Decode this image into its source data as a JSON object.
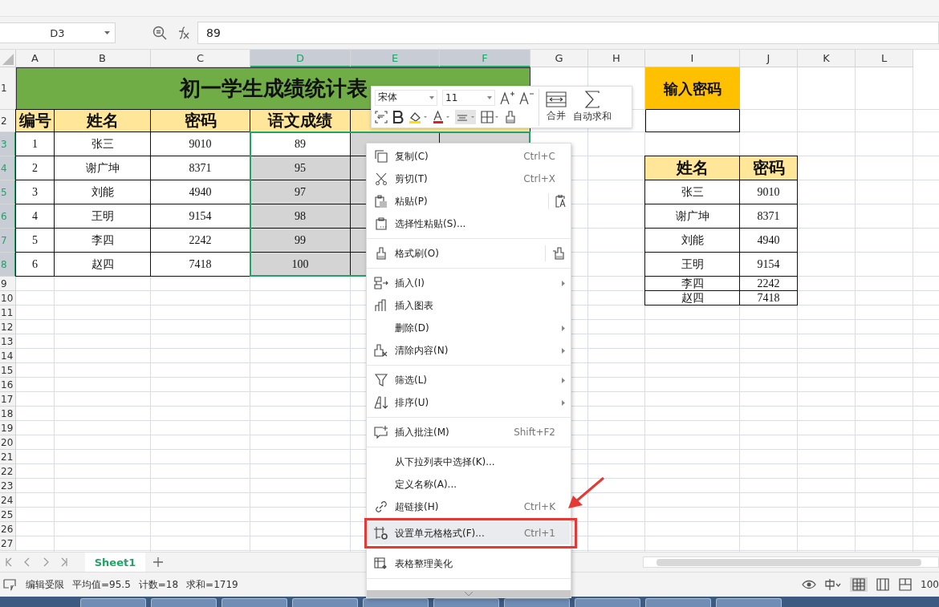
{
  "name_box": "D3",
  "formula": "89",
  "columns": [
    {
      "label": "A",
      "selected": false
    },
    {
      "label": "B",
      "selected": false
    },
    {
      "label": "C",
      "selected": false
    },
    {
      "label": "D",
      "selected": true
    },
    {
      "label": "E",
      "selected": true
    },
    {
      "label": "F",
      "selected": true
    },
    {
      "label": "G",
      "selected": false
    },
    {
      "label": "H",
      "selected": false
    },
    {
      "label": "I",
      "selected": false
    },
    {
      "label": "J",
      "selected": false
    },
    {
      "label": "K",
      "selected": false
    },
    {
      "label": "L",
      "selected": false
    }
  ],
  "rows": [
    {
      "label": "1",
      "selected": false
    },
    {
      "label": "2",
      "selected": false
    },
    {
      "label": "3",
      "selected": true
    },
    {
      "label": "4",
      "selected": true
    },
    {
      "label": "5",
      "selected": true
    },
    {
      "label": "6",
      "selected": true
    },
    {
      "label": "7",
      "selected": true
    },
    {
      "label": "8",
      "selected": true
    },
    {
      "label": "9",
      "selected": false
    },
    {
      "label": "10",
      "selected": false
    },
    {
      "label": "11",
      "selected": false
    },
    {
      "label": "12",
      "selected": false
    },
    {
      "label": "13",
      "selected": false
    },
    {
      "label": "14",
      "selected": false
    },
    {
      "label": "15",
      "selected": false
    },
    {
      "label": "16",
      "selected": false
    },
    {
      "label": "17",
      "selected": false
    },
    {
      "label": "18",
      "selected": false
    },
    {
      "label": "19",
      "selected": false
    },
    {
      "label": "20",
      "selected": false
    },
    {
      "label": "21",
      "selected": false
    },
    {
      "label": "22",
      "selected": false
    },
    {
      "label": "23",
      "selected": false
    },
    {
      "label": "24",
      "selected": false
    },
    {
      "label": "25",
      "selected": false
    },
    {
      "label": "26",
      "selected": false
    },
    {
      "label": "27",
      "selected": false
    }
  ],
  "title": "初一学生成绩统计表",
  "headers": [
    "编号",
    "姓名",
    "密码",
    "语文成绩"
  ],
  "students": [
    {
      "no": "1",
      "name": "张三",
      "code": "9010",
      "score": "89",
      "active": true
    },
    {
      "no": "2",
      "name": "谢广坤",
      "code": "8371",
      "score": "95",
      "active": false
    },
    {
      "no": "3",
      "name": "刘能",
      "code": "4940",
      "score": "97",
      "active": false
    },
    {
      "no": "4",
      "name": "王明",
      "code": "9154",
      "score": "98",
      "active": false
    },
    {
      "no": "5",
      "name": "李四",
      "code": "2242",
      "score": "99",
      "active": false
    },
    {
      "no": "6",
      "name": "赵四",
      "code": "7418",
      "score": "100",
      "active": false
    }
  ],
  "password_label": "输入密码",
  "lookup": {
    "headers": [
      "姓名",
      "密码"
    ],
    "rows": [
      [
        "张三",
        "9010"
      ],
      [
        "谢广坤",
        "8371"
      ],
      [
        "刘能",
        "4940"
      ],
      [
        "王明",
        "9154"
      ],
      [
        "李四",
        "2242"
      ],
      [
        "赵四",
        "7418"
      ]
    ]
  },
  "mini_toolbar": {
    "font": "宋体",
    "size": "11",
    "merge": "合并",
    "autosum": "自动求和"
  },
  "menu": [
    {
      "kind": "item",
      "label": "复制(C)",
      "shortcut": "Ctrl+C",
      "submenu": false,
      "selected": false
    },
    {
      "kind": "item",
      "label": "剪切(T)",
      "shortcut": "Ctrl+X",
      "submenu": false,
      "selected": false
    },
    {
      "kind": "split",
      "label": "粘贴(P)",
      "submenu": false,
      "selected": false
    },
    {
      "kind": "item",
      "label": "选择性粘贴(S)...",
      "submenu": false,
      "selected": false
    },
    {
      "kind": "separator"
    },
    {
      "kind": "split",
      "label": "格式刷(O)",
      "submenu": false,
      "selected": false
    },
    {
      "kind": "separator"
    },
    {
      "kind": "item",
      "label": "插入(I)",
      "submenu": true,
      "selected": false
    },
    {
      "kind": "item",
      "label": "插入图表",
      "submenu": false,
      "selected": false
    },
    {
      "kind": "item",
      "label": "删除(D)",
      "submenu": true,
      "selected": false
    },
    {
      "kind": "item",
      "label": "清除内容(N)",
      "submenu": true,
      "selected": false
    },
    {
      "kind": "separator"
    },
    {
      "kind": "item",
      "label": "筛选(L)",
      "submenu": true,
      "selected": false
    },
    {
      "kind": "item",
      "label": "排序(U)",
      "submenu": true,
      "selected": false
    },
    {
      "kind": "separator"
    },
    {
      "kind": "item",
      "label": "插入批注(M)",
      "shortcut": "Shift+F2",
      "submenu": false,
      "selected": false
    },
    {
      "kind": "separator"
    },
    {
      "kind": "item",
      "label": "从下拉列表中选择(K)...",
      "submenu": false,
      "selected": false
    },
    {
      "kind": "item",
      "label": "定义名称(A)...",
      "submenu": false,
      "selected": false
    },
    {
      "kind": "item",
      "label": "超链接(H)",
      "shortcut": "Ctrl+K",
      "submenu": false,
      "selected": false
    },
    {
      "kind": "item",
      "label": "设置单元格格式(F)...",
      "shortcut": "Ctrl+1",
      "submenu": false,
      "selected": true
    },
    {
      "kind": "item",
      "label": "表格整理美化",
      "submenu": false,
      "selected": false
    }
  ],
  "sheet_tabs": [
    {
      "label": "Sheet1",
      "selected": true
    }
  ],
  "status": {
    "mode": "编辑受限",
    "stats": [
      "平均值=95.5",
      "计数=18",
      "求和=1719"
    ],
    "zoom": "100"
  }
}
